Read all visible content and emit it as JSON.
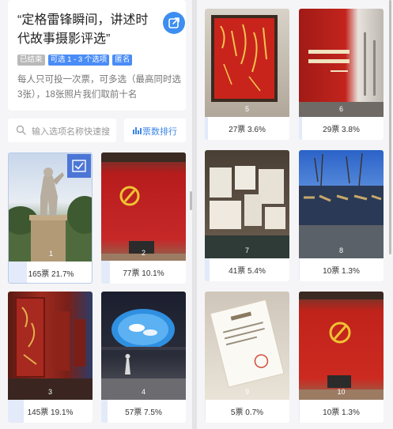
{
  "header": {
    "title": "“定格雷锋瞬间，讲述时代故事摄影评选”",
    "tags": [
      "已结束",
      "可选 1 - 3 个选项",
      "匿名"
    ],
    "description": "每人只可投一次票，可多选（最高同时选3张），18张照片我们取前十名"
  },
  "search": {
    "placeholder": "输入选项名称快速搜"
  },
  "rank_button": {
    "label": "票数排行"
  },
  "colors": {
    "accent": "#3d8ef0",
    "selected": "#4c76d6",
    "vote_fill": "#e3eaf9"
  },
  "options": [
    {
      "id": 1,
      "number": "1",
      "votes_label": "165票 21.7%",
      "percent": 21.7,
      "selected": true
    },
    {
      "id": 2,
      "number": "2",
      "votes_label": "77票 10.1%",
      "percent": 10.1,
      "selected": false
    },
    {
      "id": 3,
      "number": "3",
      "votes_label": "145票 19.1%",
      "percent": 19.1,
      "selected": false
    },
    {
      "id": 4,
      "number": "4",
      "votes_label": "57票 7.5%",
      "percent": 7.5,
      "selected": false
    },
    {
      "id": 5,
      "number": "5",
      "votes_label": "27票 3.6%",
      "percent": 3.6,
      "selected": false
    },
    {
      "id": 6,
      "number": "6",
      "votes_label": "29票 3.8%",
      "percent": 3.8,
      "selected": false
    },
    {
      "id": 7,
      "number": "7",
      "votes_label": "41票 5.4%",
      "percent": 5.4,
      "selected": false
    },
    {
      "id": 8,
      "number": "8",
      "votes_label": "10票 1.3%",
      "percent": 1.3,
      "selected": false
    },
    {
      "id": 9,
      "number": "9",
      "votes_label": "5票 0.7%",
      "percent": 0.7,
      "selected": false
    },
    {
      "id": 10,
      "number": "10",
      "votes_label": "10票 1.3%",
      "percent": 1.3,
      "selected": false
    }
  ]
}
